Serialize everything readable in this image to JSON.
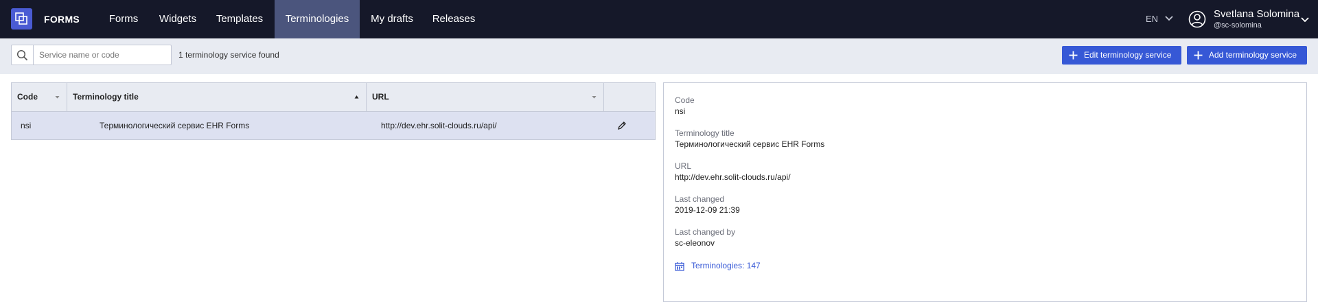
{
  "app": {
    "brand": "FORMS"
  },
  "nav": {
    "items": [
      {
        "label": "Forms"
      },
      {
        "label": "Widgets"
      },
      {
        "label": "Templates"
      },
      {
        "label": "Terminologies"
      },
      {
        "label": "My drafts"
      },
      {
        "label": "Releases"
      }
    ],
    "active_index": 3
  },
  "user": {
    "language": "EN",
    "name": "Svetlana Solomina",
    "login": "@sc-solomina"
  },
  "toolbar": {
    "search_placeholder": "Service name or code",
    "search_value": "",
    "found_text": "1 terminology service found",
    "edit_button": "Edit terminology service",
    "add_button": "Add terminology service"
  },
  "table": {
    "columns": [
      {
        "label": "Code",
        "sort": "none"
      },
      {
        "label": "Terminology title",
        "sort": "asc"
      },
      {
        "label": "URL",
        "sort": "none"
      }
    ],
    "rows": [
      {
        "code": "nsi",
        "title": "Терминологический сервис EHR Forms",
        "url": "http://dev.ehr.solit-clouds.ru/api/"
      }
    ]
  },
  "details": {
    "code_label": "Code",
    "code_value": "nsi",
    "title_label": "Terminology title",
    "title_value": "Терминологический сервис EHR Forms",
    "url_label": "URL",
    "url_value": "http://dev.ehr.solit-clouds.ru/api/",
    "changed_label": "Last changed",
    "changed_value": "2019-12-09 21:39",
    "changed_by_label": "Last changed by",
    "changed_by_value": "sc-eleonov",
    "terminologies_link": "Terminologies: 147"
  },
  "colors": {
    "nav_bg": "#151829",
    "nav_active": "#4b557d",
    "accent": "#3658d6",
    "toolbar_bg": "#e8ebf2",
    "selected_row": "#dde1f1"
  },
  "icons": [
    "app-logo-icon",
    "chevron-down-icon",
    "user-circle-icon",
    "search-icon",
    "plus-icon",
    "sort-desc-icon",
    "sort-asc-icon",
    "pencil-icon",
    "calendar-icon"
  ]
}
